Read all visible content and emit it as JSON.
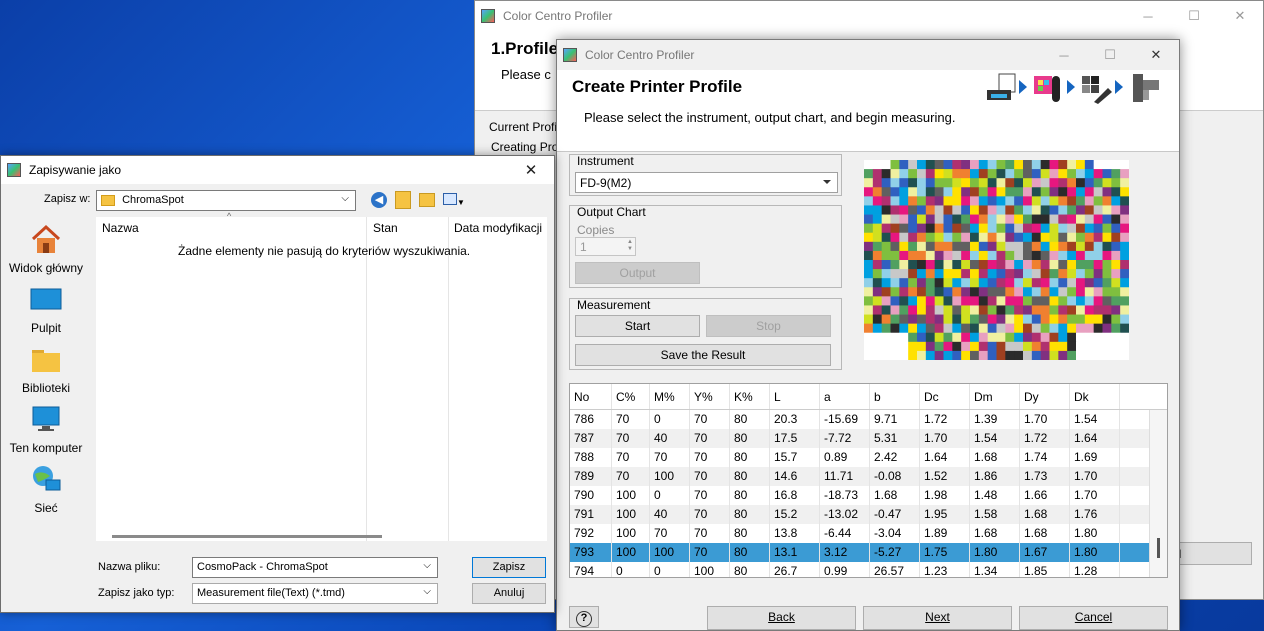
{
  "back_window": {
    "title": "Color Centro Profiler",
    "heading": "1.Profile",
    "sub": "Please c",
    "labels": [
      "Current Profi",
      "Creating Pro"
    ],
    "cancel_label": "cel"
  },
  "main_window": {
    "title": "Color Centro Profiler",
    "heading": "Create Printer Profile",
    "subtitle": "Please select the instrument, output chart, and begin measuring.",
    "instrument": {
      "label": "Instrument",
      "value": "FD-9(M2)"
    },
    "output_chart": {
      "label": "Output Chart",
      "copies_label": "Copies",
      "copies_value": "1",
      "output_button": "Output"
    },
    "measurement": {
      "label": "Measurement",
      "start": "Start",
      "stop": "Stop",
      "save": "Save the Result"
    },
    "table": {
      "columns": [
        "No",
        "C%",
        "M%",
        "Y%",
        "K%",
        "L",
        "a",
        "b",
        "Dc",
        "Dm",
        "Dy",
        "Dk"
      ],
      "rows": [
        [
          "786",
          "70",
          "0",
          "70",
          "80",
          "20.3",
          "-15.69",
          "9.71",
          "1.72",
          "1.39",
          "1.70",
          "1.54"
        ],
        [
          "787",
          "70",
          "40",
          "70",
          "80",
          "17.5",
          "-7.72",
          "5.31",
          "1.70",
          "1.54",
          "1.72",
          "1.64"
        ],
        [
          "788",
          "70",
          "70",
          "70",
          "80",
          "15.7",
          "0.89",
          "2.42",
          "1.64",
          "1.68",
          "1.74",
          "1.69"
        ],
        [
          "789",
          "70",
          "100",
          "70",
          "80",
          "14.6",
          "11.71",
          "-0.08",
          "1.52",
          "1.86",
          "1.73",
          "1.70"
        ],
        [
          "790",
          "100",
          "0",
          "70",
          "80",
          "16.8",
          "-18.73",
          "1.68",
          "1.98",
          "1.48",
          "1.66",
          "1.70"
        ],
        [
          "791",
          "100",
          "40",
          "70",
          "80",
          "15.2",
          "-13.02",
          "-0.47",
          "1.95",
          "1.58",
          "1.68",
          "1.76"
        ],
        [
          "792",
          "100",
          "70",
          "70",
          "80",
          "13.8",
          "-6.44",
          "-3.04",
          "1.89",
          "1.68",
          "1.68",
          "1.80"
        ],
        [
          "793",
          "100",
          "100",
          "70",
          "80",
          "13.1",
          "3.12",
          "-5.27",
          "1.75",
          "1.80",
          "1.67",
          "1.80"
        ],
        [
          "794",
          "0",
          "0",
          "100",
          "80",
          "26.7",
          "0.99",
          "26.57",
          "1.23",
          "1.34",
          "1.85",
          "1.28"
        ]
      ],
      "selected_row": 7
    },
    "help": "?",
    "back": "Back",
    "next": "Next",
    "cancel": "Cancel"
  },
  "save_dialog": {
    "title": "Zapisywanie jako",
    "save_in_label": "Zapisz w:",
    "save_in_value": "ChromaSpot",
    "sidebar": [
      "Widok główny",
      "Pulpit",
      "Biblioteki",
      "Ten komputer",
      "Sieć"
    ],
    "columns": [
      "Nazwa",
      "Stan",
      "Data modyfikacji"
    ],
    "empty_message": "Żadne elementy nie pasują do kryteriów wyszukiwania.",
    "filename_label": "Nazwa pliku:",
    "filename_value": "CosmoPack - ChromaSpot",
    "filetype_label": "Zapisz jako typ:",
    "filetype_value": "Measurement file(Text) (*.tmd)",
    "save_button": "Zapisz",
    "cancel_button": "Anuluj"
  }
}
